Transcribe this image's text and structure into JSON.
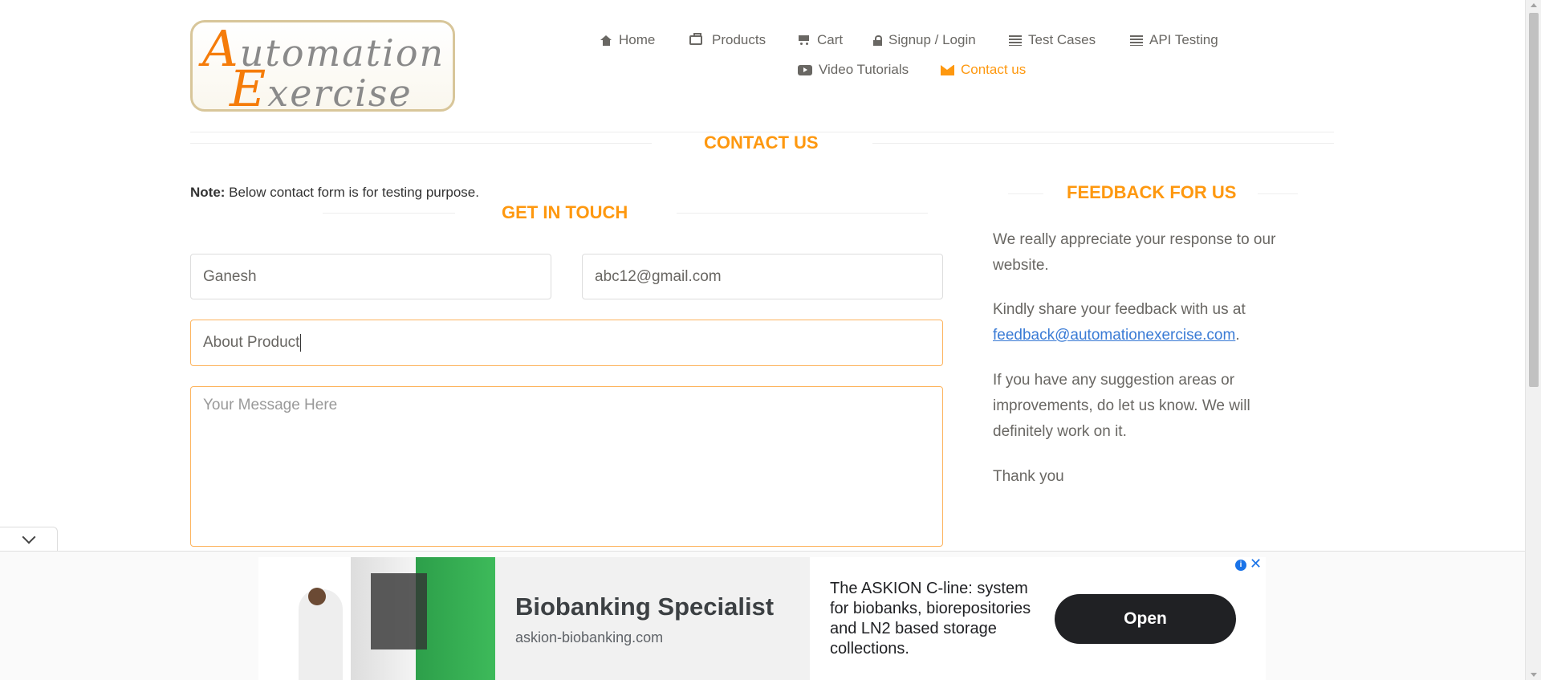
{
  "logo": {
    "line1_cap": "A",
    "line1_rest": "utomation",
    "line2_cap": "E",
    "line2_rest": "xercise"
  },
  "nav": {
    "home": "Home",
    "products": "Products",
    "cart": "Cart",
    "signup": "Signup / Login",
    "test_cases": "Test Cases",
    "api_testing": "API Testing",
    "video_tutorials": "Video Tutorials",
    "contact_us": "Contact us"
  },
  "page": {
    "title": "CONTACT US",
    "note_bold": "Note:",
    "note_text": " Below contact form is for testing purpose.",
    "form_title": "GET IN TOUCH"
  },
  "form": {
    "name_value": "Ganesh",
    "email_value": "abc12@gmail.com",
    "subject_value": "About Product",
    "message_placeholder": "Your Message Here"
  },
  "feedback": {
    "title": "FEEDBACK FOR US",
    "p1": "We really appreciate your response to our website.",
    "p2_text": "Kindly share your feedback with us at",
    "p2_email": "feedback@automationexercise.com",
    "p2_end": ".",
    "p3": "If you have any suggestion areas or improvements, do let us know. We will definitely work on it.",
    "p4": "Thank you"
  },
  "ad": {
    "headline": "Biobanking Specialist",
    "url": "askion-biobanking.com",
    "description": "The ASKION C-line: system for biobanks, biorepositories and LN2 based storage collections.",
    "cta": "Open",
    "info_glyph": "i",
    "close_glyph": "✕"
  },
  "icons": [
    "house-icon",
    "briefcase-icon",
    "cart-icon",
    "lock-icon",
    "list-icon",
    "video-icon",
    "envelope-icon",
    "chevron-down-icon",
    "info-icon",
    "close-icon"
  ],
  "colors": {
    "accent": "#fe980f",
    "text": "#696763",
    "link": "#3a7bd5"
  }
}
